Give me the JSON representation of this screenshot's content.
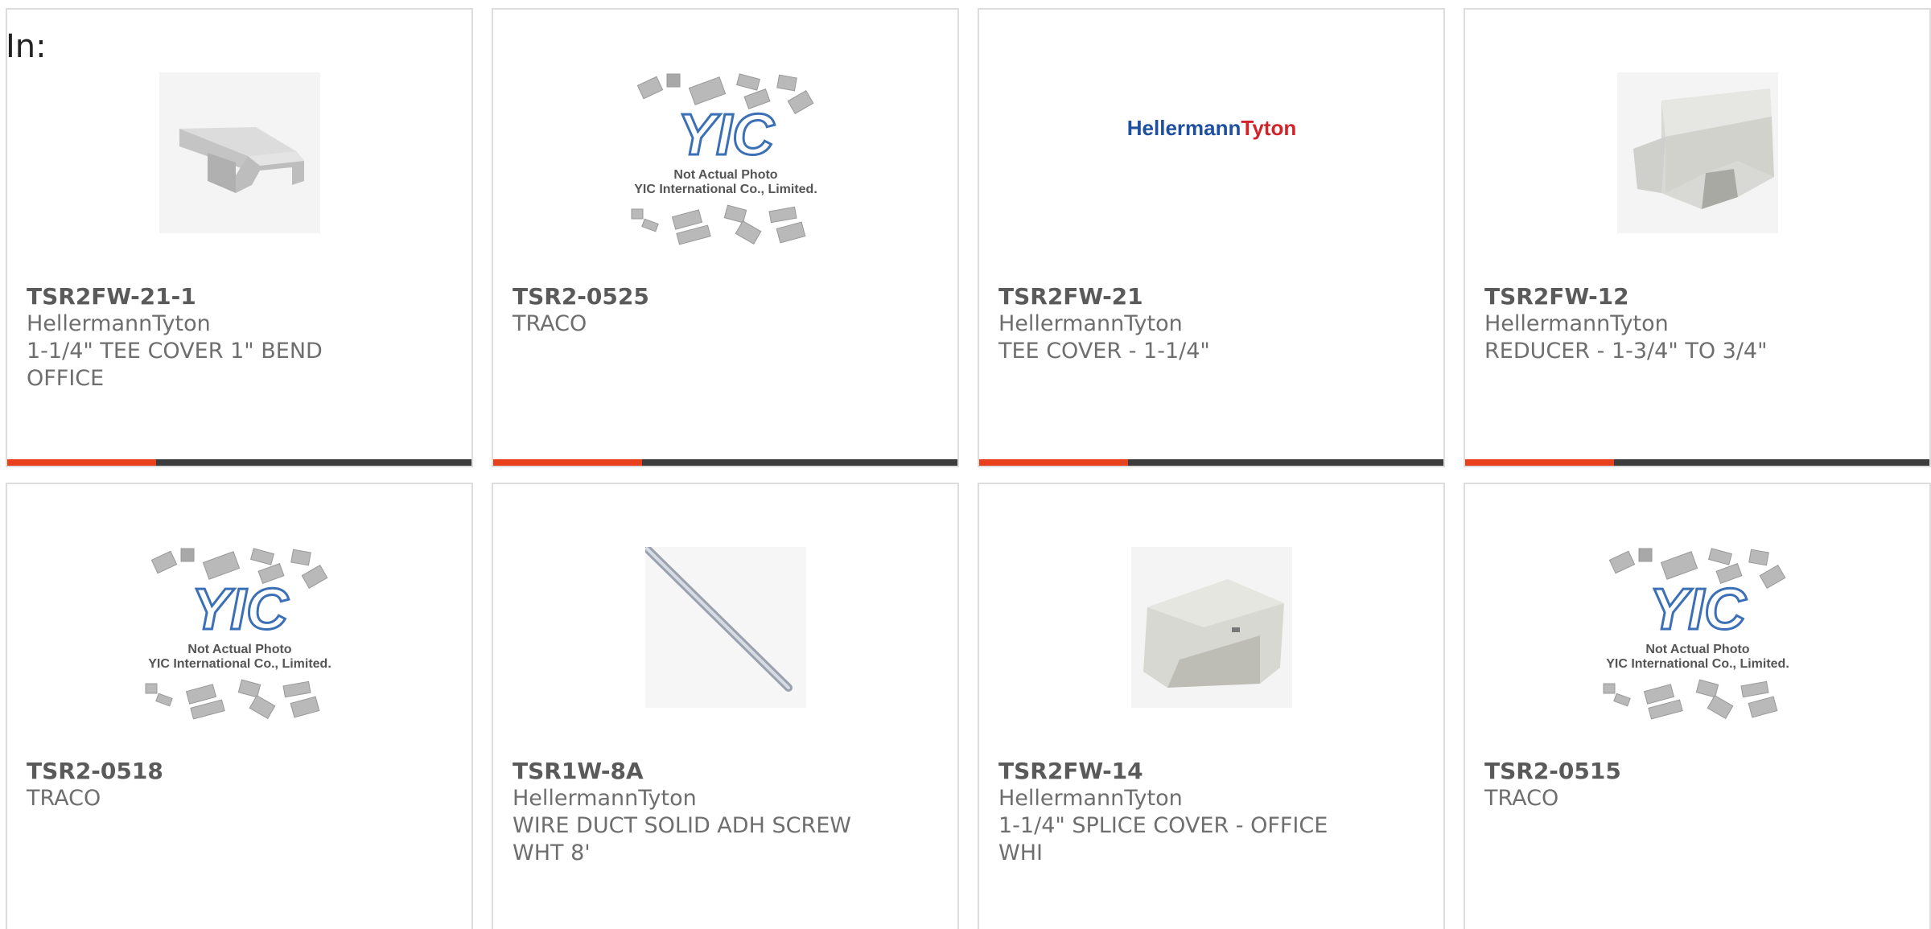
{
  "header": {
    "label": "In:"
  },
  "theme": {
    "accent": "#e8401c",
    "bar": "#3c3c3c",
    "border": "#dddddd",
    "text": "#666666"
  },
  "products": [
    {
      "part": "TSR2FW-21-1",
      "mfr": "HellermannTyton",
      "desc": "1-1/4\" TEE COVER 1\" BEND OFFICE",
      "image": "tee-cover-photo"
    },
    {
      "part": "TSR2-0525",
      "mfr": "TRACO",
      "desc": "",
      "image": "yic-placeholder"
    },
    {
      "part": "TSR2FW-21",
      "mfr": "HellermannTyton",
      "desc": "TEE COVER - 1-1/4\"",
      "image": "hellermanntyton-logo"
    },
    {
      "part": "TSR2FW-12",
      "mfr": "HellermannTyton",
      "desc": "REDUCER - 1-3/4\" TO 3/4\"",
      "image": "reducer-photo"
    },
    {
      "part": "TSR2-0518",
      "mfr": "TRACO",
      "desc": "",
      "image": "yic-placeholder"
    },
    {
      "part": "TSR1W-8A",
      "mfr": "HellermannTyton",
      "desc": "WIRE DUCT SOLID ADH SCREW WHT 8'",
      "image": "wire-duct-photo"
    },
    {
      "part": "TSR2FW-14",
      "mfr": "HellermannTyton",
      "desc": "1-1/4\" SPLICE COVER - OFFICE WHI",
      "image": "splice-cover-photo"
    },
    {
      "part": "TSR2-0515",
      "mfr": "TRACO",
      "desc": "",
      "image": "yic-placeholder"
    }
  ],
  "placeholder": {
    "line1": "Not Actual Photo",
    "line2": "YIC International Co., Limited.",
    "brand": "YIC"
  },
  "logo_text": {
    "left": "Hellermann",
    "right": "Tyton"
  }
}
